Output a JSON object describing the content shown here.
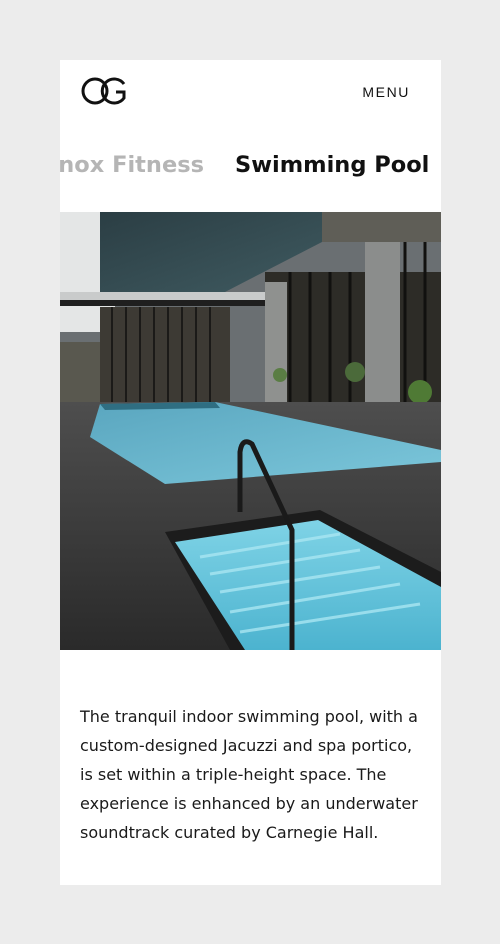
{
  "header": {
    "logo_text": "OG",
    "menu_label": "MENU"
  },
  "tabs": {
    "items": [
      {
        "label": "Equinox Fitness",
        "state": "inactive"
      },
      {
        "label": "Swimming Pool",
        "state": "active"
      }
    ]
  },
  "content": {
    "description": "The tranquil indoor swimming pool, with a custom-designed Jacuzzi and spa portico, is set within a triple-height space. The experience is enhanced by an underwater soundtrack curated by Carnegie Hall."
  },
  "colors": {
    "page_background": "#ececec",
    "card_background": "#ffffff",
    "text": "#111111",
    "inactive_tab": "#b5b5b5"
  }
}
